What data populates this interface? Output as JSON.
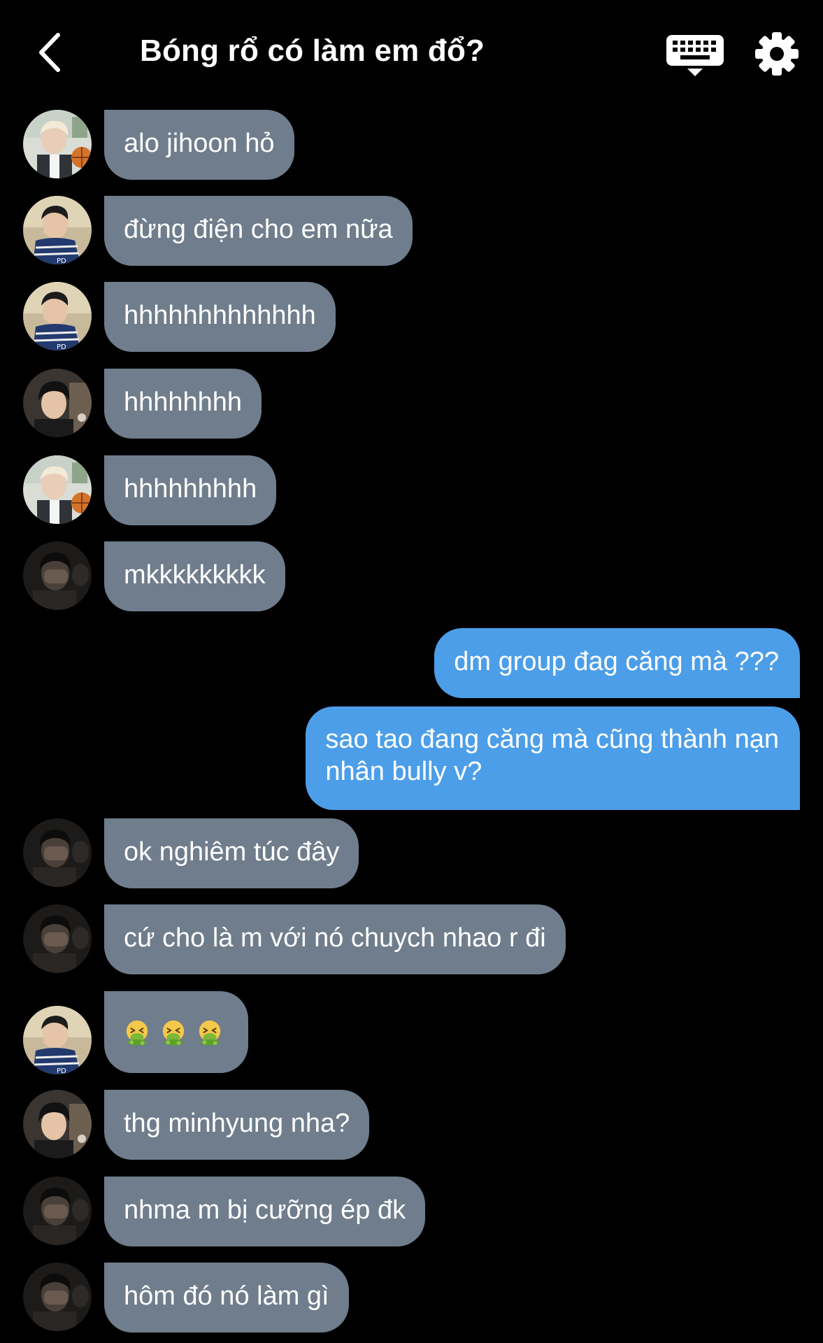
{
  "header": {
    "title": "Bóng rổ có làm em đổ?",
    "back_icon": "chevron-left-icon",
    "keyboard_icon": "keyboard-icon",
    "settings_icon": "gear-icon"
  },
  "colors": {
    "background": "#000000",
    "incoming_bubble": "#6f7d8c",
    "outgoing_bubble": "#4c9ee8",
    "text": "#ffffff"
  },
  "messages": [
    {
      "sender": "blond-boy",
      "direction": "incoming",
      "text": "alo jihoon hỏ"
    },
    {
      "sender": "peace-sign-boy",
      "direction": "incoming",
      "text": "đừng điện cho em nữa"
    },
    {
      "sender": "peace-sign-boy",
      "direction": "incoming",
      "text": "hhhhhhhhhhhhh"
    },
    {
      "sender": "dark-hair-boy",
      "direction": "incoming",
      "text": "hhhhhhhh"
    },
    {
      "sender": "blond-boy",
      "direction": "incoming",
      "text": "hhhhhhhhh"
    },
    {
      "sender": "face-cover-boy",
      "direction": "incoming",
      "text": "mkkkkkkkkk"
    },
    {
      "sender": "me",
      "direction": "outgoing",
      "text": "dm group đag căng mà ???"
    },
    {
      "sender": "me",
      "direction": "outgoing",
      "lines": [
        "sao tao đang căng mà cũng thành nạn",
        "nhân bully v?"
      ]
    },
    {
      "sender": "face-cover-boy",
      "direction": "incoming",
      "text": "ok nghiêm túc đây"
    },
    {
      "sender": "face-cover-boy",
      "direction": "incoming",
      "text": "cứ cho là m với nó chuych nhao r đi"
    },
    {
      "sender": "peace-sign-boy",
      "direction": "incoming",
      "emoji": [
        "vomiting-face-emoji",
        "vomiting-face-emoji",
        "vomiting-face-emoji"
      ]
    },
    {
      "sender": "dark-hair-boy",
      "direction": "incoming",
      "text": "thg minhyung nha?"
    },
    {
      "sender": "face-cover-boy",
      "direction": "incoming",
      "text": "nhma m bị cưỡng ép đk"
    },
    {
      "sender": "face-cover-boy",
      "direction": "incoming",
      "text": "hôm đó nó làm gì"
    }
  ]
}
